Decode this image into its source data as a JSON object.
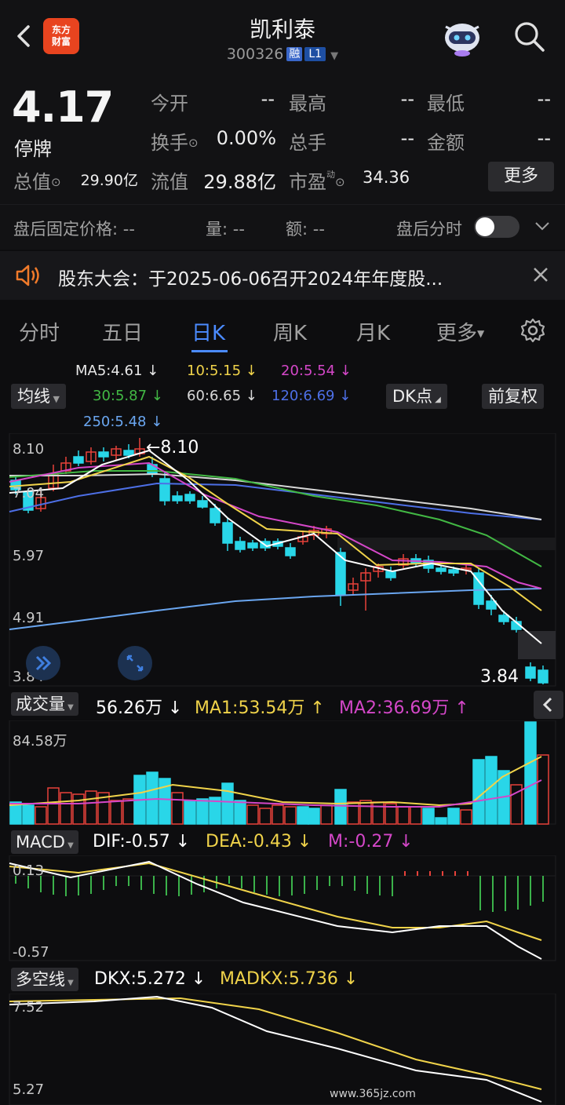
{
  "header": {
    "title": "凯利泰",
    "code": "300326",
    "margin_tag": "融",
    "level_tag": "L1",
    "logo_line1": "东方",
    "logo_line2": "财富"
  },
  "quote": {
    "price": "4.17",
    "status": "停牌",
    "rows": [
      [
        {
          "label": "今开",
          "value": "--"
        },
        {
          "label": "最高",
          "value": "--"
        },
        {
          "label": "最低",
          "value": "--"
        }
      ],
      [
        {
          "label": "换手",
          "value": "0.00%"
        },
        {
          "label": "总手",
          "value": "--"
        },
        {
          "label": "金额",
          "value": "--"
        }
      ]
    ],
    "total_cap_label": "总值",
    "total_cap": "29.90亿",
    "float_cap_label": "流值",
    "float_cap": "29.88亿",
    "pe_label": "市盈",
    "pe_sup": "动",
    "pe": "34.36",
    "more_label": "更多"
  },
  "after_hours": {
    "price_label": "盘后固定价格:",
    "price_value": "--",
    "vol_label": "量:",
    "vol_value": "--",
    "amt_label": "额:",
    "amt_value": "--",
    "intraday_label": "盘后分时"
  },
  "notice": {
    "text": "股东大会：于2025-06-06召开2024年年度股..."
  },
  "tabs": [
    "分时",
    "五日",
    "日K",
    "周K",
    "月K",
    "更多"
  ],
  "active_tab": "日K",
  "ma_panel": {
    "selector": "均线",
    "dk_button": "DK点",
    "adjust_button": "前复权",
    "items": [
      {
        "text": "MA5:4.61 ↓",
        "color": "#ffffff"
      },
      {
        "text": "10:5.15 ↓",
        "color": "#f0d34a"
      },
      {
        "text": "20:5.54 ↓",
        "color": "#d447c8"
      },
      {
        "text": "30:5.87 ↓",
        "color": "#42b844"
      },
      {
        "text": "60:6.65 ↓",
        "color": "#d8d8d8"
      },
      {
        "text": "120:6.69 ↓",
        "color": "#4d6fe6"
      },
      {
        "text": "250:5.48 ↓",
        "color": "#6aa6f0"
      }
    ]
  },
  "kline_axis": {
    "y_ticks": [
      "8.10",
      "7.04",
      "5.97",
      "4.91",
      "3.84"
    ],
    "high_label": "←8.10",
    "low_label": "3.84"
  },
  "volume_panel": {
    "label": "成交量",
    "value": "56.26万 ↓",
    "ma1": "MA1:53.54万 ↑",
    "ma2": "MA2:36.69万 ↑",
    "top_label": "84.58万"
  },
  "macd_panel": {
    "label": "MACD",
    "dif": "DIF:-0.57 ↓",
    "dea": "DEA:-0.43 ↓",
    "m": "M:-0.27 ↓",
    "top_label": "0.13",
    "bottom_label": "-0.57"
  },
  "dkx_panel": {
    "label": "多空线",
    "dkx": "DKX:5.272 ↓",
    "madkx": "MADKX:5.736 ↓",
    "top_label": "7.52",
    "bottom_label": "5.27"
  },
  "watermark": "www.365jz.com",
  "colors": {
    "up": "#e8413a",
    "down": "#29d6e8",
    "accent": "#4b8bff"
  }
}
